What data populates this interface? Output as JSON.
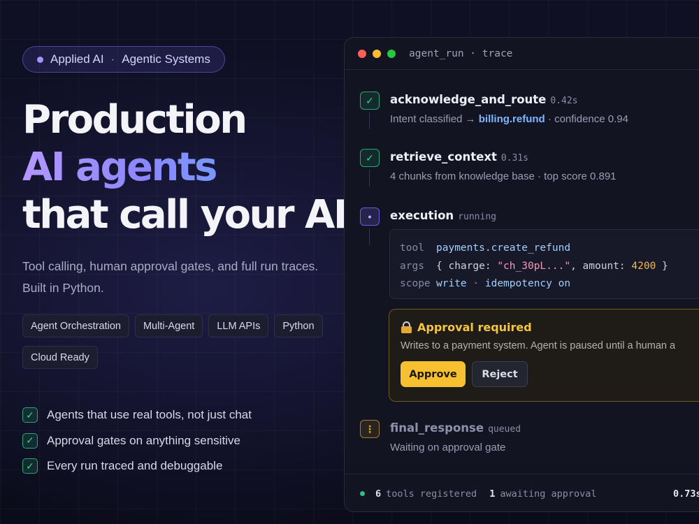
{
  "hero": {
    "eyebrow_primary": "Applied AI",
    "eyebrow_separator": "·",
    "eyebrow_secondary": "Agentic Systems",
    "headline_line1": "Production",
    "headline_line2": "AI agents",
    "headline_line3": "that call your APIs",
    "subtitle_line1": "Tool calling, human approval gates, and full run traces.",
    "subtitle_line2": "Built in Python.",
    "chips": [
      "Agent Orchestration",
      "Multi-Agent",
      "LLM APIs",
      "Python",
      "Cloud Ready"
    ],
    "checks": [
      "Agents that use real tools, not just chat",
      "Approval gates on anything sensitive",
      "Every run traced and debuggable"
    ],
    "check_glyph": "✓"
  },
  "trace": {
    "title": "agent_run · trace",
    "steps": [
      {
        "name": "acknowledge_and_route",
        "meta": "0.42s",
        "status": "done",
        "desc_before": "Intent classified → ",
        "desc_highlight": "billing.refund",
        "desc_after": " · confidence 0.94"
      },
      {
        "name": "retrieve_context",
        "meta": "0.31s",
        "status": "done",
        "desc": "4 chunks from knowledge base · top score 0.891"
      },
      {
        "name": "execution",
        "meta": "running",
        "status": "running"
      },
      {
        "name": "final_response",
        "meta": "queued",
        "status": "queued",
        "desc": "Waiting on approval gate"
      }
    ],
    "code": {
      "tool_key": "tool",
      "tool_value": "payments.create_refund",
      "args_key": "args",
      "args_open": "{ charge: ",
      "args_charge": "\"ch_30pL...\"",
      "args_mid": ", amount: ",
      "args_amount": "4200",
      "args_close": " }",
      "scope_key": "scope",
      "scope_value": "write",
      "scope_sep": " · ",
      "idempotency_label": "idempotency",
      "idempotency_value": "on"
    },
    "approval": {
      "title": "Approval required",
      "desc": "Writes to a payment system. Agent is paused until a human a",
      "approve_label": "Approve",
      "reject_label": "Reject"
    },
    "footer": {
      "tools_count": "6",
      "tools_label": "tools registered",
      "awaiting_count": "1",
      "awaiting_label": "awaiting approval",
      "elapsed": "0.73s"
    },
    "glyphs": {
      "done": "✓",
      "running": "•",
      "queued": "⋮"
    }
  },
  "colors": {
    "accent_purple": "#a693ff",
    "success_green": "#3ed38d",
    "warning_amber": "#f5c542",
    "link_blue": "#7fb6ff"
  }
}
